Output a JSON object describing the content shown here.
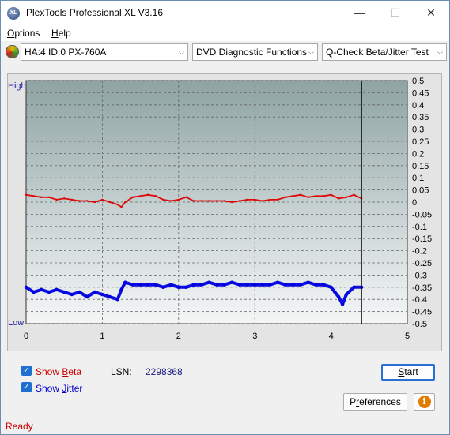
{
  "window": {
    "title": "PlexTools Professional XL V3.16",
    "logo_text": "XL",
    "minimize_glyph": "—",
    "maximize_glyph": "☐",
    "close_glyph": "✕"
  },
  "menu": [
    {
      "prefix": "",
      "accel": "O",
      "rest": "ptions"
    },
    {
      "prefix": "",
      "accel": "H",
      "rest": "elp"
    }
  ],
  "toolbar": {
    "drive": "HA:4 ID:0  PX-760A",
    "function": "DVD Diagnostic Functions",
    "test": "Q-Check Beta/Jitter Test",
    "drive_icon": "disc-icon",
    "arrow": "⌵"
  },
  "chart_data": {
    "type": "line",
    "left_axis_labels": [
      "High",
      "Low"
    ],
    "x_ticks": [
      "0",
      "1",
      "2",
      "3",
      "4",
      "5"
    ],
    "xlim": [
      0,
      5
    ],
    "y_ticks": [
      "0.5",
      "0.45",
      "0.4",
      "0.35",
      "0.3",
      "0.25",
      "0.2",
      "0.15",
      "0.1",
      "0.05",
      "0",
      "-0.05",
      "-0.1",
      "-0.15",
      "-0.2",
      "-0.25",
      "-0.3",
      "-0.35",
      "-0.4",
      "-0.45",
      "-0.5"
    ],
    "ylim": [
      -0.5,
      0.5
    ],
    "grid": true,
    "cursor_x": 4.4,
    "series": [
      {
        "color": "#e00000",
        "x": [
          0,
          0.1,
          0.2,
          0.3,
          0.4,
          0.5,
          0.6,
          0.7,
          0.8,
          0.9,
          1.0,
          1.1,
          1.2,
          1.25,
          1.3,
          1.4,
          1.5,
          1.6,
          1.7,
          1.8,
          1.9,
          2.0,
          2.1,
          2.2,
          2.3,
          2.4,
          2.5,
          2.6,
          2.7,
          2.8,
          2.9,
          3.0,
          3.1,
          3.2,
          3.3,
          3.4,
          3.5,
          3.6,
          3.7,
          3.8,
          3.9,
          4.0,
          4.1,
          4.2,
          4.3,
          4.4
        ],
        "values": [
          0.03,
          0.025,
          0.02,
          0.02,
          0.01,
          0.015,
          0.01,
          0.005,
          0.005,
          0.0,
          0.01,
          0.0,
          -0.01,
          -0.02,
          0.0,
          0.02,
          0.025,
          0.03,
          0.025,
          0.01,
          0.005,
          0.01,
          0.02,
          0.005,
          0.005,
          0.005,
          0.005,
          0.005,
          0.0,
          0.005,
          0.01,
          0.01,
          0.005,
          0.01,
          0.01,
          0.02,
          0.025,
          0.03,
          0.02,
          0.025,
          0.025,
          0.03,
          0.015,
          0.02,
          0.03,
          0.015
        ]
      },
      {
        "color": "#0000e0",
        "x": [
          0,
          0.1,
          0.2,
          0.3,
          0.4,
          0.5,
          0.6,
          0.7,
          0.8,
          0.9,
          1.0,
          1.1,
          1.2,
          1.25,
          1.3,
          1.4,
          1.5,
          1.6,
          1.7,
          1.8,
          1.9,
          2.0,
          2.1,
          2.2,
          2.3,
          2.4,
          2.5,
          2.6,
          2.7,
          2.8,
          2.9,
          3.0,
          3.1,
          3.2,
          3.3,
          3.4,
          3.5,
          3.6,
          3.7,
          3.8,
          3.9,
          4.0,
          4.05,
          4.1,
          4.15,
          4.2,
          4.3,
          4.4
        ],
        "values": [
          -0.35,
          -0.37,
          -0.36,
          -0.37,
          -0.36,
          -0.37,
          -0.38,
          -0.37,
          -0.39,
          -0.37,
          -0.38,
          -0.39,
          -0.4,
          -0.36,
          -0.33,
          -0.34,
          -0.34,
          -0.34,
          -0.34,
          -0.35,
          -0.34,
          -0.35,
          -0.35,
          -0.34,
          -0.34,
          -0.33,
          -0.34,
          -0.34,
          -0.33,
          -0.34,
          -0.34,
          -0.34,
          -0.34,
          -0.34,
          -0.33,
          -0.34,
          -0.34,
          -0.34,
          -0.33,
          -0.34,
          -0.34,
          -0.35,
          -0.37,
          -0.39,
          -0.42,
          -0.38,
          -0.35,
          -0.35
        ]
      }
    ]
  },
  "options": {
    "show_beta": {
      "prefix": "Show ",
      "accel": "B",
      "rest": "eta",
      "checked": true
    },
    "show_jitter": {
      "prefix": "Show ",
      "accel": "J",
      "rest": "itter",
      "checked": true
    },
    "check_glyph": "✓"
  },
  "lsn": {
    "label": "LSN:",
    "value": "2298368"
  },
  "buttons": {
    "start": {
      "accel": "S",
      "rest": "tart"
    },
    "preferences": {
      "prefix": "P",
      "accel": "r",
      "rest": "eferences"
    },
    "info_glyph": "i"
  },
  "status": "Ready",
  "colors": {
    "beta": "#e00000",
    "jitter": "#0000e0",
    "status": "#cc0000",
    "accent": "#1e6fd0"
  }
}
